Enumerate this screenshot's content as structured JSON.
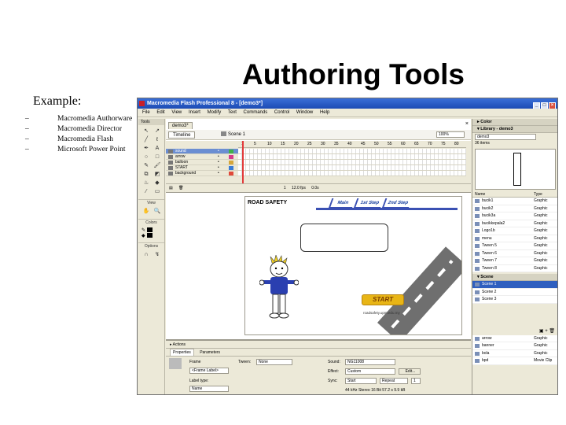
{
  "slide": {
    "title": "Authoring Tools",
    "example_label": "Example:",
    "bullets": [
      {
        "dash": "–",
        "text": "Macromedia Authorware"
      },
      {
        "dash": "–",
        "text": "Macromedia Director"
      },
      {
        "dash": "–",
        "text": "Macromedia Flash"
      },
      {
        "dash": "–",
        "text": "Microsoft Power Point"
      }
    ]
  },
  "app": {
    "window_title": "Macromedia Flash Professional 8 - [demo3*]",
    "menu": [
      "File",
      "Edit",
      "View",
      "Insert",
      "Modify",
      "Text",
      "Commands",
      "Control",
      "Window",
      "Help"
    ],
    "doc_tab": "demo3*",
    "timeline_button": "Timeline",
    "scene_label": "Scene 1",
    "zoom": "100%",
    "frame_numbers": [
      "1",
      "5",
      "10",
      "15",
      "20",
      "25",
      "30",
      "35",
      "40",
      "45",
      "50",
      "55",
      "60",
      "65",
      "70",
      "75",
      "80"
    ],
    "layers": [
      "sound",
      "arrow",
      "balloon",
      "START",
      "background"
    ],
    "timeline_status": {
      "frame": "1",
      "fps": "12.0 fps",
      "time": "0.0s"
    },
    "tools": {
      "header": "Tools",
      "icons": [
        "arrow-icon",
        "subselect-icon",
        "line-icon",
        "lasso-icon",
        "pen-icon",
        "text-icon",
        "oval-icon",
        "rect-icon",
        "pencil-icon",
        "brush-icon",
        "freetransform-icon",
        "fill-transform-icon",
        "inkbottle-icon",
        "paintbucket-icon",
        "eyedropper-icon",
        "eraser-icon"
      ],
      "sections": [
        "View",
        "Colors",
        "Options"
      ]
    },
    "stage": {
      "brand": "ROAD SAFETY",
      "nav": [
        "Main",
        "1st Step",
        "2nd Step"
      ],
      "start": "START",
      "url": "roadsafety.upm.edu.my"
    },
    "actions_label": "Actions",
    "properties": {
      "tabs": [
        "Properties",
        "Parameters"
      ],
      "frame_label": "Frame",
      "frame_placeholder": "<Frame Label>",
      "label_type": "Label type:",
      "label_type_value": "Name",
      "tween_label": "Tween:",
      "tween_value": "None",
      "sound_label": "Sound:",
      "sound_value": "NG11008",
      "effect_label": "Effect:",
      "effect_value": "Custom",
      "edit_button": "Edit...",
      "sync_label": "Sync:",
      "sync_value": "Start",
      "repeat_value": "Repeat",
      "repeat_count": "1",
      "sound_info": "44 kHz Stereo 16 Bit 57.2 s 9.9 kB"
    },
    "right_panel": {
      "color_header": "Color",
      "library_header": "Library - demo3",
      "library_dropdown": "demo3",
      "item_count": "36 items",
      "col_name": "Name",
      "col_type": "Type",
      "library_items": [
        {
          "name": "bucik1",
          "type": "Graphic"
        },
        {
          "name": "bucik2",
          "type": "Graphic"
        },
        {
          "name": "bucik3a",
          "type": "Graphic"
        },
        {
          "name": "bucikkepala2",
          "type": "Graphic"
        },
        {
          "name": "Logo1b",
          "type": "Graphic"
        },
        {
          "name": "menu",
          "type": "Graphic"
        },
        {
          "name": "Tween 5",
          "type": "Graphic"
        },
        {
          "name": "Tween 6",
          "type": "Graphic"
        },
        {
          "name": "Tween 7",
          "type": "Graphic"
        },
        {
          "name": "Tween 8",
          "type": "Graphic"
        }
      ],
      "scene_header": "Scene",
      "scenes": [
        "Scene 1",
        "Scene 2",
        "Scene 3"
      ],
      "bottom_items": [
        {
          "name": "arrow",
          "type": "Graphic"
        },
        {
          "name": "banner",
          "type": "Graphic"
        },
        {
          "name": "bola",
          "type": "Graphic"
        },
        {
          "name": "bpd",
          "type": "Movie Clip"
        }
      ]
    }
  }
}
